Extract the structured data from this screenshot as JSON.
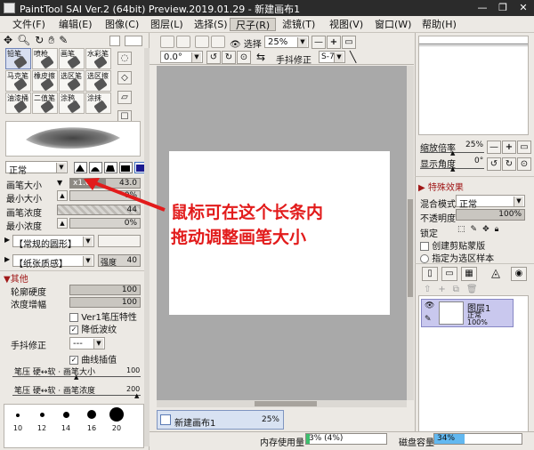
{
  "window": {
    "title": "PaintTool SAI Ver.2 (64bit) Preview.2019.01.29 - 新建画布1",
    "minimize": "—",
    "restore": "❐",
    "close": "✕"
  },
  "menubar": [
    "文件(F)",
    "编辑(E)",
    "图像(C)",
    "图层(L)",
    "选择(S)",
    "尺子(R)",
    "滤镜(T)",
    "视图(V)",
    "窗口(W)",
    "帮助(H)"
  ],
  "toolbar": {
    "selection_label": "选择",
    "zoom_value": "25%",
    "rotation_value": "0.0°",
    "stabilizer_label": "手抖修正",
    "stabilizer_value": "S-7"
  },
  "tools": [
    {
      "label": "铅笔"
    },
    {
      "label": "喷枪"
    },
    {
      "label": "画笔"
    },
    {
      "label": "水彩笔"
    },
    {
      "label": "马克笔"
    },
    {
      "label": "橡皮擦"
    },
    {
      "label": "选区笔"
    },
    {
      "label": "选区擦"
    },
    {
      "label": "油漆桶"
    },
    {
      "label": "二值笔"
    },
    {
      "label": "涂鸦"
    },
    {
      "label": "涂抹"
    }
  ],
  "brush": {
    "mode": "正常",
    "size_label": "画笔大小",
    "size_multiplier": "x1.0",
    "size_value": "43.0",
    "min_size_label": "最小大小",
    "min_size_value": "0%",
    "density_label": "画笔浓度",
    "density_value": "44",
    "min_density_label": "最小浓度",
    "min_density_value": "0%",
    "shape_dropdown": "【常规的圆形】",
    "texture_dropdown": "【纸张质感】",
    "texture_strength_label": "强度",
    "texture_strength_value": "40",
    "other_section": "其他",
    "edge_hardness_label": "轮廓硬度",
    "edge_hardness_value": "100",
    "density_increase_label": "浓度增幅",
    "density_increase_value": "100",
    "ver1_pressure_label": "Ver1笔压特性",
    "reduce_ripple_label": "降低波纹",
    "stabilizer_label": "手抖修正",
    "stabilizer_value": "---",
    "curve_interp_label": "曲线插值",
    "pressure_size_label": "笔压 硬↔软 · 画笔大小",
    "pressure_size_value": "100",
    "pressure_density_label": "笔压 硬↔软 · 画笔浓度",
    "pressure_density_value": "200",
    "preset_sizes": [
      "10",
      "12",
      "14",
      "16",
      "20"
    ]
  },
  "annotation": {
    "line1": "鼠标可在这个长条内",
    "line2": "拖动调整画笔大小"
  },
  "right_panel": {
    "zoom_label": "缩放倍率",
    "zoom_value": "25%",
    "angle_label": "显示角度",
    "angle_value": "0°",
    "effects_section": "特殊效果",
    "blend_label": "混合模式",
    "blend_value": "正常",
    "opacity_label": "不透明度",
    "opacity_value": "100%",
    "lock_label": "锁定",
    "clipping_label": "创建剪贴蒙版",
    "reference_label": "指定为选区样本",
    "layer_name": "图层1",
    "layer_mode": "正常",
    "layer_opacity": "100%"
  },
  "status": {
    "canvas_tab": "新建画布1",
    "canvas_tab_zoom": "25%",
    "memory_label": "内存使用量",
    "memory_value": "3% (4%)",
    "disk_label": "磁盘容量",
    "disk_value": "34%"
  },
  "colors": {
    "canvas_bg": "#a9a9a9",
    "title_bg": "#2b2b2b",
    "annotation_red": "#e21b1b",
    "accent_blue": "#3c6ebf"
  }
}
